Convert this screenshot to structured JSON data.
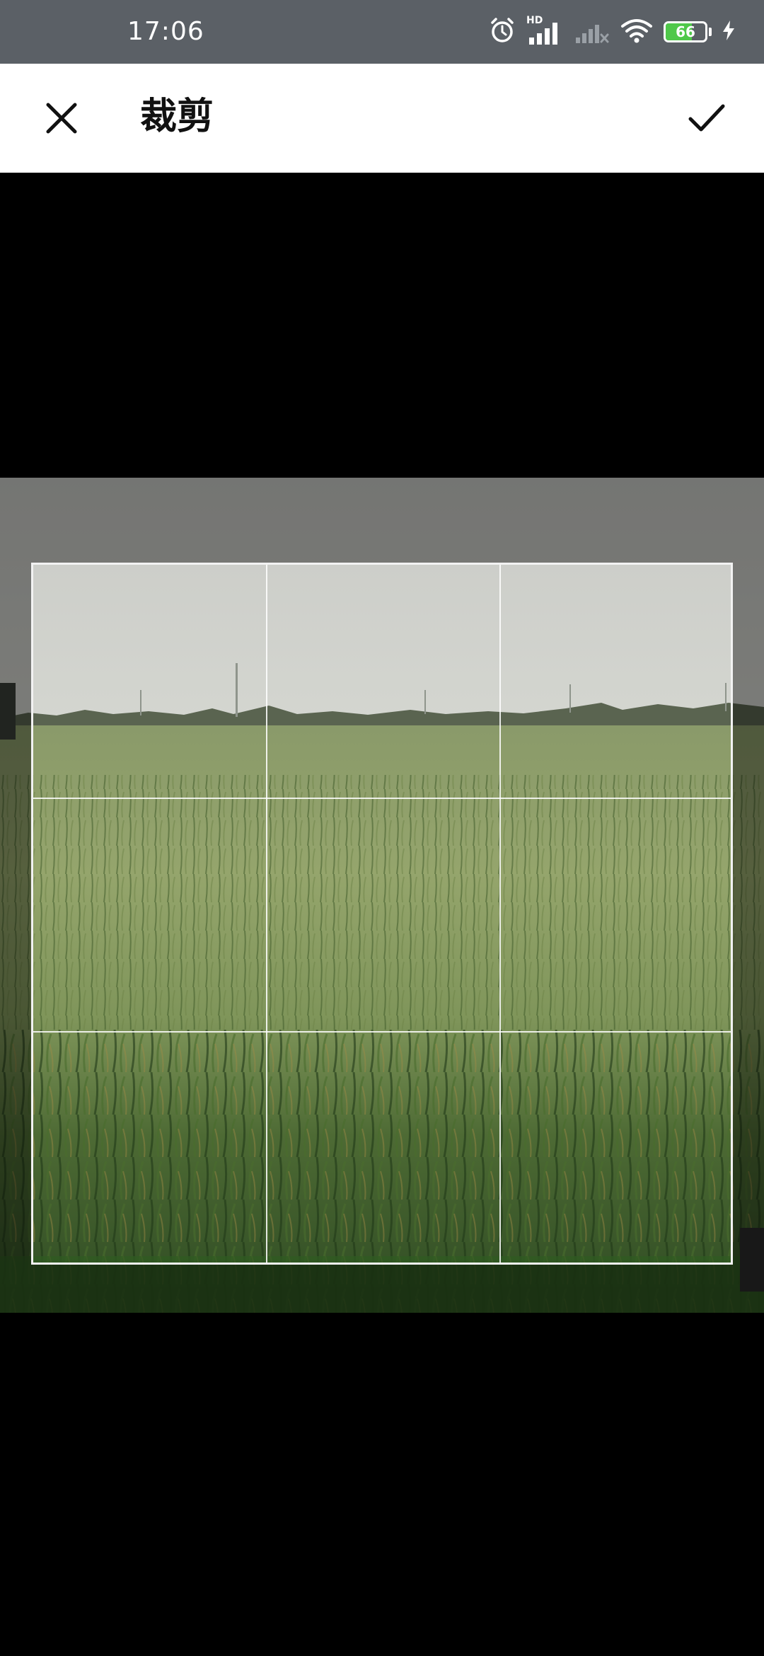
{
  "status_bar": {
    "time": "17:06",
    "icons": [
      "alarm-icon",
      "hd-signal-icon",
      "signal-no-service-icon",
      "wifi-icon",
      "battery-icon",
      "charging-bolt-icon"
    ],
    "network_badge": "HD",
    "battery_level": 66,
    "battery_text": "66",
    "battery_color": "#4fc84a"
  },
  "top_bar": {
    "title": "裁剪",
    "close_icon": "close-icon",
    "confirm_icon": "check-icon"
  },
  "crop": {
    "grid": "3x3"
  },
  "colors": {
    "status_bar_bg": "#5b6066",
    "top_bar_bg": "#ffffff",
    "canvas_bg": "#000000",
    "crop_line": "#f2f2f2"
  }
}
